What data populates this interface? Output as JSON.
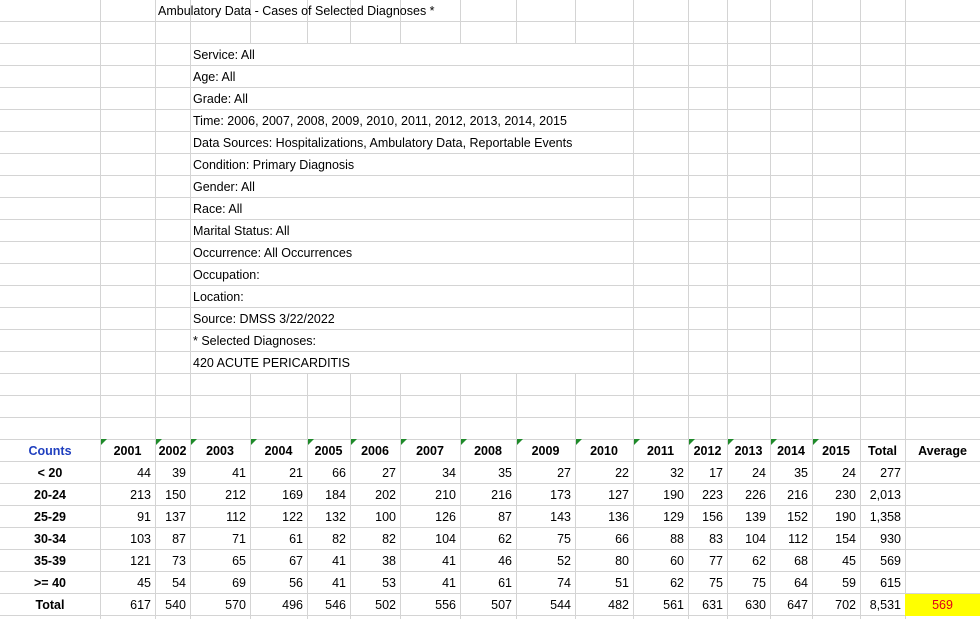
{
  "title": "Ambulatory Data - Cases of Selected Diagnoses *",
  "filters": [
    "Service: All",
    "Age: All",
    "Grade: All",
    "Time: 2006, 2007, 2008, 2009, 2010, 2011, 2012, 2013, 2014, 2015",
    "Data Sources: Hospitalizations, Ambulatory Data, Reportable Events",
    "Condition: Primary Diagnosis",
    "Gender: All",
    "Race: All",
    "Marital Status: All",
    "Occurrence: All Occurrences",
    "Occupation:",
    "Location:",
    "Source: DMSS 3/22/2022",
    "* Selected Diagnoses:",
    "420 ACUTE PERICARDITIS"
  ],
  "table": {
    "corner_label": "Counts",
    "years": [
      "2001",
      "2002",
      "2003",
      "2004",
      "2005",
      "2006",
      "2007",
      "2008",
      "2009",
      "2010",
      "2011",
      "2012",
      "2013",
      "2014",
      "2015"
    ],
    "total_label": "Total",
    "average_label": "Average",
    "rows": [
      {
        "label": "< 20",
        "values": [
          "44",
          "39",
          "41",
          "21",
          "66",
          "27",
          "34",
          "35",
          "27",
          "22",
          "32",
          "17",
          "24",
          "35",
          "24"
        ],
        "total": "277"
      },
      {
        "label": "20-24",
        "values": [
          "213",
          "150",
          "212",
          "169",
          "184",
          "202",
          "210",
          "216",
          "173",
          "127",
          "190",
          "223",
          "226",
          "216",
          "230"
        ],
        "total": "2,013"
      },
      {
        "label": "25-29",
        "values": [
          "91",
          "137",
          "112",
          "122",
          "132",
          "100",
          "126",
          "87",
          "143",
          "136",
          "129",
          "156",
          "139",
          "152",
          "190"
        ],
        "total": "1,358"
      },
      {
        "label": "30-34",
        "values": [
          "103",
          "87",
          "71",
          "61",
          "82",
          "82",
          "104",
          "62",
          "75",
          "66",
          "88",
          "83",
          "104",
          "112",
          "154"
        ],
        "total": "930"
      },
      {
        "label": "35-39",
        "values": [
          "121",
          "73",
          "65",
          "67",
          "41",
          "38",
          "41",
          "46",
          "52",
          "80",
          "60",
          "77",
          "62",
          "68",
          "45"
        ],
        "total": "569"
      },
      {
        "label": ">= 40",
        "values": [
          "45",
          "54",
          "69",
          "56",
          "41",
          "53",
          "41",
          "61",
          "74",
          "51",
          "62",
          "75",
          "75",
          "64",
          "59"
        ],
        "total": "615"
      },
      {
        "label": "Total",
        "values": [
          "617",
          "540",
          "570",
          "496",
          "546",
          "502",
          "556",
          "507",
          "544",
          "482",
          "561",
          "631",
          "630",
          "647",
          "702"
        ],
        "total": "8,531"
      }
    ],
    "average_value": "569"
  },
  "colors": {
    "gridline": "#d4d4d4",
    "counts_label": "#1f3fbf",
    "error_triangle": "#1f8a2a",
    "highlight_fill": "#ffff00",
    "highlight_text": "#e0001b"
  }
}
